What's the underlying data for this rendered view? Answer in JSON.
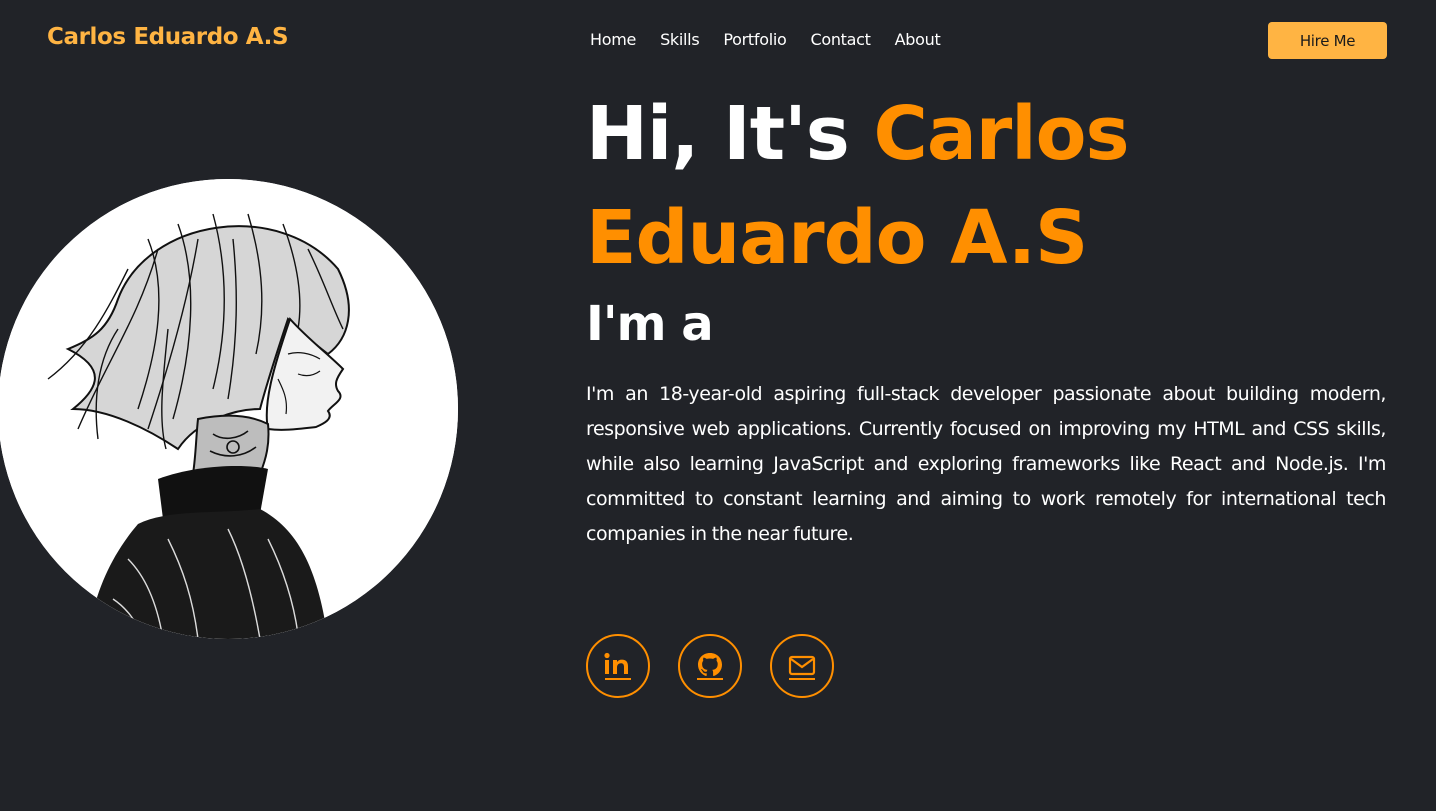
{
  "header": {
    "logo": "Carlos Eduardo A.S",
    "nav": [
      "Home",
      "Skills",
      "Portfolio",
      "Contact",
      "About"
    ],
    "cta": "Hire Me"
  },
  "hero": {
    "greeting": "Hi, It's",
    "name": "Carlos Eduardo A.S",
    "role_prefix": "I'm a",
    "bio": "I'm an 18-year-old aspiring full-stack developer passionate about building modern, responsive web applications. Currently focused on improving my HTML and CSS skills, while also learning JavaScript and exploring frameworks like React and Node.js. I'm committed to constant learning and aiming to work remotely for international tech companies in the near future."
  },
  "socials": [
    {
      "icon": "linkedin-icon"
    },
    {
      "icon": "github-icon"
    },
    {
      "icon": "mail-icon"
    }
  ],
  "colors": {
    "background": "#212328",
    "accent": "#ff8f00",
    "logo": "#ffb443",
    "button": "#ffb443",
    "text": "#ffffff"
  }
}
